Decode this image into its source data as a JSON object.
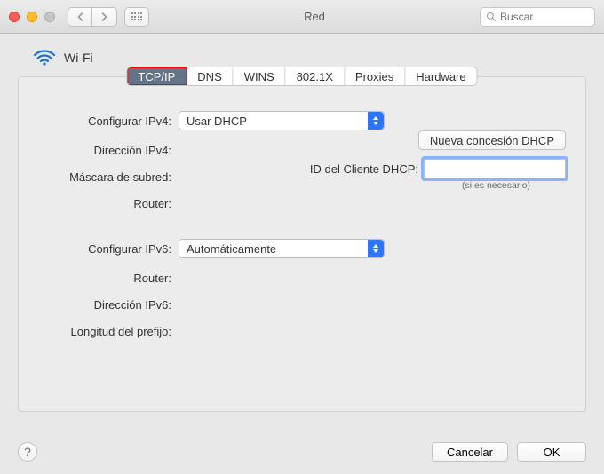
{
  "window": {
    "title": "Red",
    "search_placeholder": "Buscar"
  },
  "header": {
    "interface_name": "Wi-Fi"
  },
  "tabs": [
    "TCP/IP",
    "DNS",
    "WINS",
    "802.1X",
    "Proxies",
    "Hardware"
  ],
  "labels": {
    "config_ipv4": "Configurar IPv4:",
    "ipv4_addr": "Dirección IPv4:",
    "subnet": "Máscara de subred:",
    "router4": "Router:",
    "config_ipv6": "Configurar IPv6:",
    "router6": "Router:",
    "ipv6_addr": "Dirección IPv6:",
    "prefix": "Longitud del prefijo:",
    "dhcp_client_id": "ID del Cliente DHCP:",
    "hint": "(si es necesario)"
  },
  "values": {
    "config_ipv4": "Usar DHCP",
    "config_ipv6": "Automáticamente",
    "dhcp_client_id": ""
  },
  "buttons": {
    "new_lease": "Nueva concesión DHCP",
    "cancel": "Cancelar",
    "ok": "OK",
    "help": "?"
  }
}
